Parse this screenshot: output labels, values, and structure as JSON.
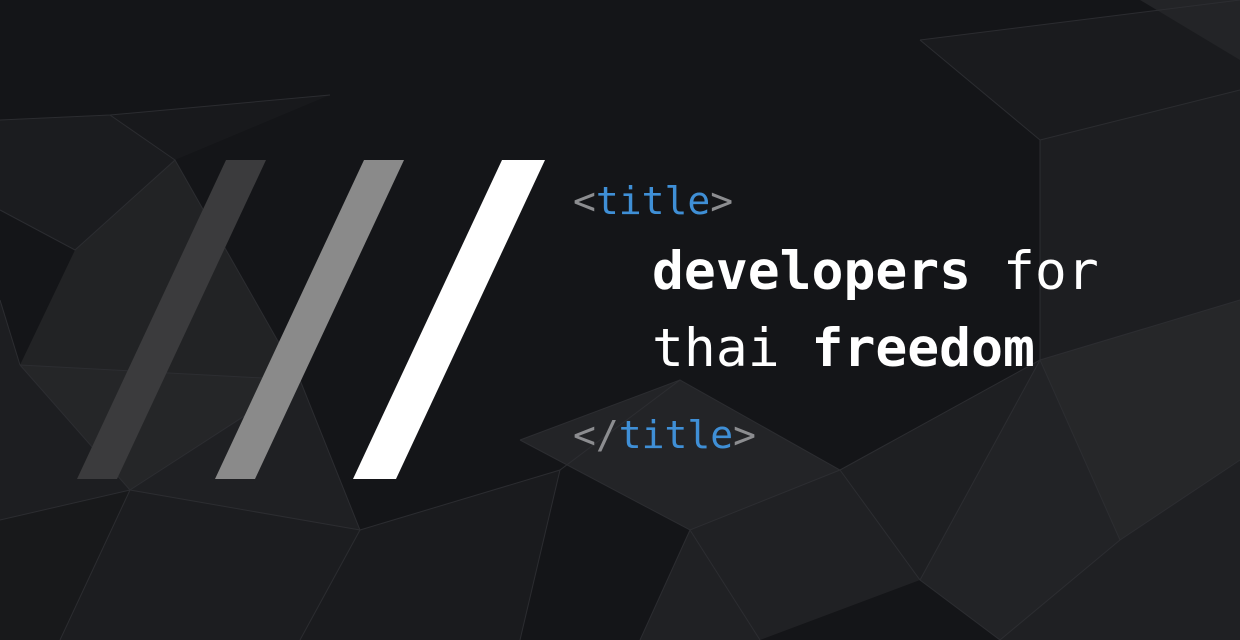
{
  "colors": {
    "background": "#141518",
    "bracket": "#8c8d90",
    "tag_name": "#3f8fd6",
    "title_text": "#ffffff",
    "slash_dark": "#3b3b3d",
    "slash_mid": "#8a8a8a",
    "slash_light": "#ffffff"
  },
  "logo": {
    "slashes": [
      "dark",
      "mid",
      "light"
    ]
  },
  "open_tag": {
    "open_bracket": "<",
    "name": "title",
    "close_bracket": ">"
  },
  "title": {
    "line1_bold": "developers",
    "line1_normal": " for",
    "line2_normal": "thai ",
    "line2_bold": "freedom"
  },
  "close_tag": {
    "open_bracket": "</",
    "name": "title",
    "close_bracket": ">"
  }
}
